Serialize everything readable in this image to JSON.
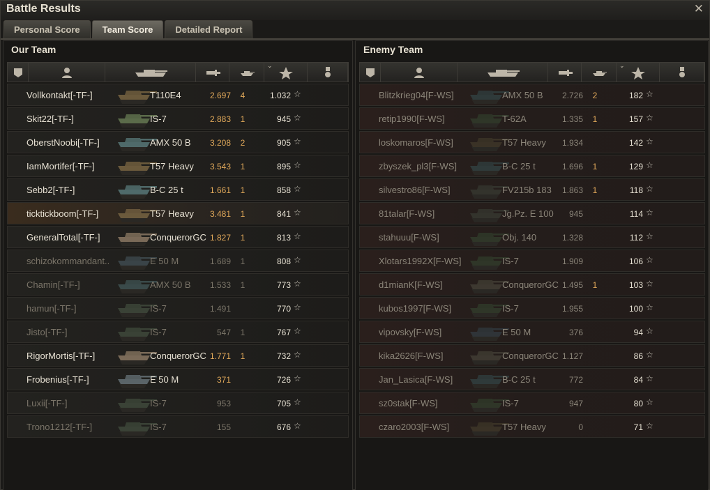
{
  "window": {
    "title": "Battle Results",
    "close_icon": "close-icon"
  },
  "tabs": [
    {
      "label": "Personal Score",
      "active": false
    },
    {
      "label": "Team Score",
      "active": true
    },
    {
      "label": "Detailed Report",
      "active": false
    }
  ],
  "columns": [
    {
      "icon": "platoon-icon"
    },
    {
      "icon": "player-icon"
    },
    {
      "icon": "tank-icon"
    },
    {
      "icon": "damage-icon"
    },
    {
      "icon": "kills-icon"
    },
    {
      "icon": "xp-star-icon",
      "sorted": true
    },
    {
      "icon": "medal-icon"
    }
  ],
  "colors": {
    "highlight_value": "#e0a85a",
    "dead_text": "#7a7468",
    "enemy_row": "#2a1f1c"
  },
  "our_team": {
    "title": "Our Team",
    "rows": [
      {
        "player": "Vollkontakt[-TF-]",
        "tank": "T110E4",
        "damage": "2.697",
        "kills": "4",
        "xp": "1.032",
        "alive": true,
        "tank_color": "#6b5a3c"
      },
      {
        "player": "Skit22[-TF-]",
        "tank": "IS-7",
        "damage": "2.883",
        "kills": "1",
        "xp": "945",
        "alive": true,
        "tank_color": "#5b6b4a"
      },
      {
        "player": "OberstNoobi[-TF-]",
        "tank": "AMX 50 B",
        "damage": "3.208",
        "kills": "2",
        "xp": "905",
        "alive": true,
        "tank_color": "#4f6a6a"
      },
      {
        "player": "IamMortifer[-TF-]",
        "tank": "T57 Heavy",
        "damage": "3.543",
        "kills": "1",
        "xp": "895",
        "alive": true,
        "tank_color": "#6b5a3c"
      },
      {
        "player": "Sebb2[-TF-]",
        "tank": "B-C 25 t",
        "damage": "1.661",
        "kills": "1",
        "xp": "858",
        "alive": true,
        "tank_color": "#4f6a6a"
      },
      {
        "player": "ticktickboom[-TF-]",
        "tank": "T57 Heavy",
        "damage": "3.481",
        "kills": "1",
        "xp": "841",
        "alive": true,
        "highlight": true,
        "tank_color": "#6b5a3c"
      },
      {
        "player": "GeneralTotal[-TF-]",
        "tank": "ConquerorGC",
        "damage": "1.827",
        "kills": "1",
        "xp": "813",
        "alive": true,
        "tank_color": "#7a6a58"
      },
      {
        "player": "schizokommandant..",
        "tank": "E 50 M",
        "damage": "1.689",
        "kills": "1",
        "xp": "808",
        "alive": false,
        "tank_color": "#3a4448"
      },
      {
        "player": "Chamin[-TF-]",
        "tank": "AMX 50 B",
        "damage": "1.533",
        "kills": "1",
        "xp": "773",
        "alive": false,
        "tank_color": "#3a4a4a"
      },
      {
        "player": "hamun[-TF-]",
        "tank": "IS-7",
        "damage": "1.491",
        "kills": "",
        "xp": "770",
        "alive": false,
        "tank_color": "#3a4236"
      },
      {
        "player": "Jisto[-TF-]",
        "tank": "IS-7",
        "damage": "547",
        "kills": "1",
        "xp": "767",
        "alive": false,
        "tank_color": "#3a4236"
      },
      {
        "player": "RigorMortis[-TF-]",
        "tank": "ConquerorGC",
        "damage": "1.771",
        "kills": "1",
        "xp": "732",
        "alive": true,
        "tank_color": "#7a6a58"
      },
      {
        "player": "Frobenius[-TF-]",
        "tank": "E 50 M",
        "damage": "371",
        "kills": "",
        "xp": "726",
        "alive": true,
        "tank_color": "#5a6468"
      },
      {
        "player": "Luxii[-TF-]",
        "tank": "IS-7",
        "damage": "953",
        "kills": "",
        "xp": "705",
        "alive": false,
        "tank_color": "#3a4236"
      },
      {
        "player": "Trono1212[-TF-]",
        "tank": "IS-7",
        "damage": "155",
        "kills": "",
        "xp": "676",
        "alive": false,
        "tank_color": "#3a4236"
      }
    ]
  },
  "enemy_team": {
    "title": "Enemy Team",
    "rows": [
      {
        "player": "Blitzkrieg04[F-WS]",
        "tank": "AMX 50 B",
        "damage": "2.726",
        "kills": "2",
        "xp": "182",
        "tank_color": "#2f3a3a"
      },
      {
        "player": "retip1990[F-WS]",
        "tank": "T-62A",
        "damage": "1.335",
        "kills": "1",
        "xp": "157",
        "tank_color": "#2f3628"
      },
      {
        "player": "loskomaros[F-WS]",
        "tank": "T57 Heavy",
        "damage": "1.934",
        "kills": "",
        "xp": "142",
        "tank_color": "#3a3226"
      },
      {
        "player": "zbyszek_pl3[F-WS]",
        "tank": "B-C 25 t",
        "damage": "1.696",
        "kills": "1",
        "xp": "129",
        "tank_color": "#2f3a3a"
      },
      {
        "player": "silvestro86[F-WS]",
        "tank": "FV215b 183",
        "damage": "1.863",
        "kills": "1",
        "xp": "118",
        "tank_color": "#33332c"
      },
      {
        "player": "81talar[F-WS]",
        "tank": "Jg.Pz. E 100",
        "damage": "945",
        "kills": "",
        "xp": "114",
        "tank_color": "#33332c"
      },
      {
        "player": "stahuuu[F-WS]",
        "tank": "Obj. 140",
        "damage": "1.328",
        "kills": "",
        "xp": "112",
        "tank_color": "#2f3628"
      },
      {
        "player": "Xlotars1992X[F-WS]",
        "tank": "IS-7",
        "damage": "1.909",
        "kills": "",
        "xp": "106",
        "tank_color": "#2f3628"
      },
      {
        "player": "d1mianK[F-WS]",
        "tank": "ConquerorGC",
        "damage": "1.495",
        "kills": "1",
        "xp": "103",
        "tank_color": "#3d3830"
      },
      {
        "player": "kubos1997[F-WS]",
        "tank": "IS-7",
        "damage": "1.955",
        "kills": "",
        "xp": "100",
        "tank_color": "#2f3628"
      },
      {
        "player": "vipovsky[F-WS]",
        "tank": "E 50 M",
        "damage": "376",
        "kills": "",
        "xp": "94",
        "tank_color": "#2f3438"
      },
      {
        "player": "kika2626[F-WS]",
        "tank": "ConquerorGC",
        "damage": "1.127",
        "kills": "",
        "xp": "86",
        "tank_color": "#3d3830"
      },
      {
        "player": "Jan_Lasica[F-WS]",
        "tank": "B-C 25 t",
        "damage": "772",
        "kills": "",
        "xp": "84",
        "tank_color": "#2f3a3a"
      },
      {
        "player": "sz0stak[F-WS]",
        "tank": "IS-7",
        "damage": "947",
        "kills": "",
        "xp": "80",
        "tank_color": "#2f3628"
      },
      {
        "player": "czaro2003[F-WS]",
        "tank": "T57 Heavy",
        "damage": "0",
        "kills": "",
        "xp": "71",
        "tank_color": "#3a3226"
      }
    ]
  }
}
